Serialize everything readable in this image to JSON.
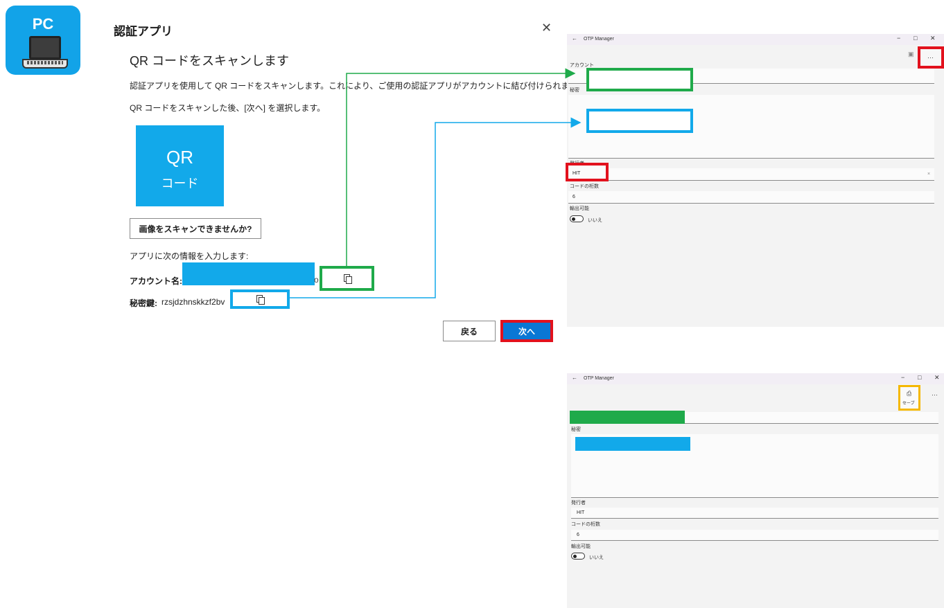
{
  "badge": {
    "label": "PC",
    "icon": "laptop-icon"
  },
  "dialog": {
    "title": "認証アプリ",
    "heading": "QR コードをスキャンします",
    "description": "認証アプリを使用して QR コードをスキャンします。これにより、ご使用の認証アプリがアカウントに結び付けられます。",
    "instruction": "QR コードをスキャンした後、[次へ] を選択します。",
    "qr_line1": "QR",
    "qr_line2": "コード",
    "cant_scan_label": "画像をスキャンできませんか?",
    "enter_info": "アプリに次の情報を入力します:",
    "account_label": "アカウント名:",
    "account_tail": "o",
    "secret_label": "秘密鍵:",
    "secret_value": "rzsjdzhnskkzf2bv",
    "back_label": "戻る",
    "next_label": "次へ"
  },
  "otp_top": {
    "window_title": "OTP Manager",
    "more_label": "···",
    "account_label": "アカウント",
    "secret_label": "秘密",
    "issuer_label": "発行者",
    "issuer_value": "HIT",
    "issuer_clear": "×",
    "digits_label": "コードの桁数",
    "digits_value": "6",
    "exportable_label": "輸出可能",
    "toggle_text": "いいえ"
  },
  "otp_bottom": {
    "window_title": "OTP Manager",
    "save_label": "セーブ",
    "more_label": "···",
    "secret_label": "秘密",
    "issuer_label": "発行者",
    "issuer_value": "HIT",
    "digits_label": "コードの桁数",
    "digits_value": "6",
    "exportable_label": "輸出可能",
    "toggle_text": "いいえ"
  },
  "colors": {
    "green": "#1faa4a",
    "blue": "#12a9ea",
    "red": "#e2111d",
    "yellow": "#f5b800",
    "primary": "#0a77d4"
  }
}
